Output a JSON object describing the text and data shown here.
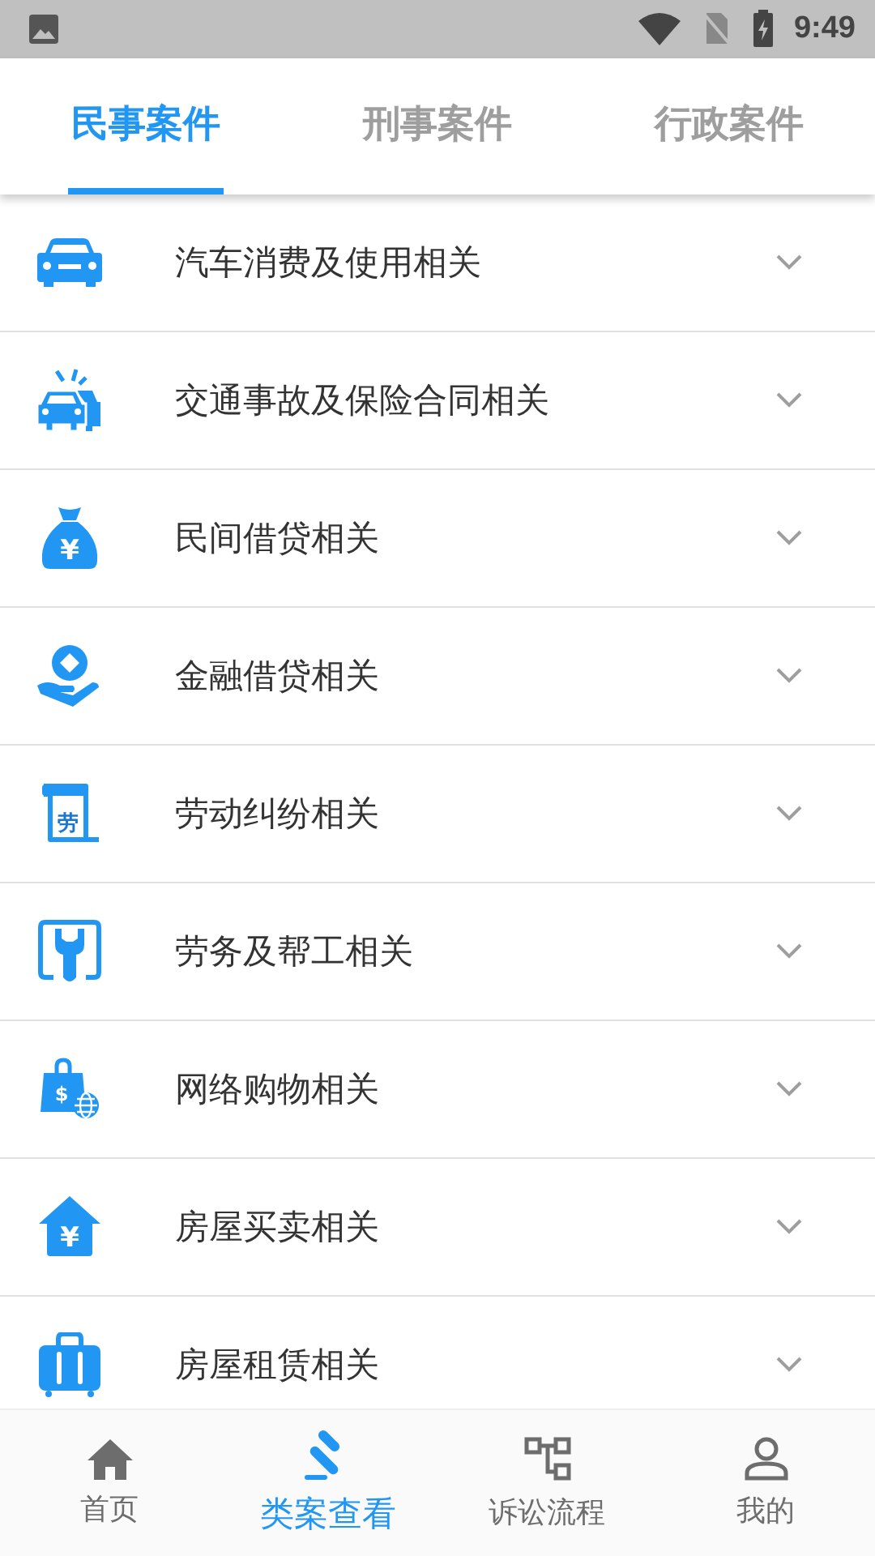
{
  "status_bar": {
    "time": "9:49"
  },
  "tabs": [
    {
      "label": "民事案件",
      "selected": true
    },
    {
      "label": "刑事案件",
      "selected": false
    },
    {
      "label": "行政案件",
      "selected": false
    }
  ],
  "categories": [
    {
      "kind": "car",
      "label": "汽车消费及使用相关",
      "expanded": false
    },
    {
      "kind": "crash",
      "label": "交通事故及保险合同相关",
      "expanded": false
    },
    {
      "kind": "moneybag",
      "label": "民间借贷相关",
      "glyph": "¥",
      "expanded": false
    },
    {
      "kind": "coinhand",
      "label": "金融借贷相关",
      "expanded": false
    },
    {
      "kind": "document",
      "label": "劳动纠纷相关",
      "glyph": "劳",
      "expanded": false
    },
    {
      "kind": "wrench",
      "label": "劳务及帮工相关",
      "expanded": false
    },
    {
      "kind": "bag",
      "label": "网络购物相关",
      "glyph": "$",
      "expanded": false
    },
    {
      "kind": "house",
      "label": "房屋买卖相关",
      "glyph": "¥",
      "expanded": false
    },
    {
      "kind": "suitcase",
      "label": "房屋租赁相关",
      "expanded": false
    }
  ],
  "bottom_nav": [
    {
      "kind": "home",
      "label": "首页",
      "selected": false
    },
    {
      "kind": "gavel",
      "label": "类案查看",
      "selected": true
    },
    {
      "kind": "flow",
      "label": "诉讼流程",
      "selected": false
    },
    {
      "kind": "person",
      "label": "我的",
      "selected": false
    }
  ]
}
